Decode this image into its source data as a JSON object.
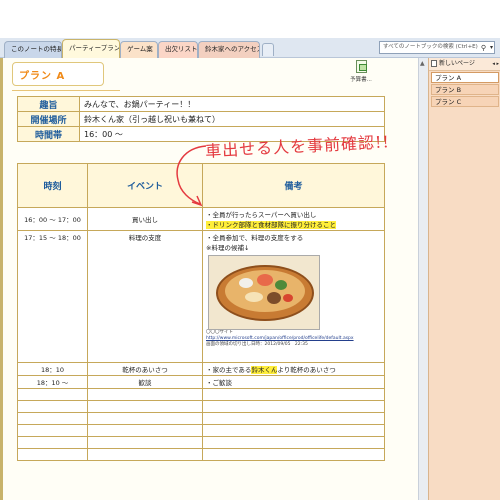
{
  "tabs": [
    {
      "label": "このノートの特長"
    },
    {
      "label": "パーティープラン"
    },
    {
      "label": "ゲーム案"
    },
    {
      "label": "出欠リスト"
    },
    {
      "label": "鈴木家へのアクセス"
    }
  ],
  "search": {
    "placeholder": "すべてのノートブックの検索 (Ctrl+E)"
  },
  "page": {
    "title": "プラン A",
    "attachment_label": "予算書..."
  },
  "info": [
    {
      "label": "趣旨",
      "value": "みんなで、お鍋パーティー！！"
    },
    {
      "label": "開催場所",
      "value": "鈴木くん家（引っ越し祝いも兼ねて）"
    },
    {
      "label": "時間帯",
      "value": "16：00 ～"
    }
  ],
  "schedule": {
    "headers": [
      "時刻",
      "イベント",
      "備考"
    ],
    "rows": [
      {
        "time": "16：00 ～ 17：00",
        "event": "買い出し",
        "note1": "・全員が行ったらスーパーへ買い出し",
        "note2": "・ドリンク部隊と食材部隊に振り分けること"
      },
      {
        "time": "17：15 ～ 18：00",
        "event": "料理の支度",
        "note1": "・全員参加で、料理の支度をする",
        "note2": "※料理の候補↓"
      },
      {
        "time": "18：10",
        "event": "乾杯のあいさつ",
        "note_pre": "・家の主である",
        "note_hl": "鈴木くん",
        "note_post": "より乾杯のあいさつ"
      },
      {
        "time": "18：10 ～",
        "event": "歓談",
        "note1": "・ご歓談"
      }
    ],
    "image_caption": "〇〇〇サイト",
    "image_link": "http://www.microsoft.com/japan/office/prod/officelife/default.aspx",
    "image_note": "画面の領域の切り出し日時：2012/09/05　22:35"
  },
  "handwritten_note": "車出せる人を事前確認!!",
  "sidebar": {
    "new_page_label": "新しいページ",
    "pages": [
      "プラン A",
      "プラン B",
      "プラン C"
    ],
    "selected": 0
  }
}
